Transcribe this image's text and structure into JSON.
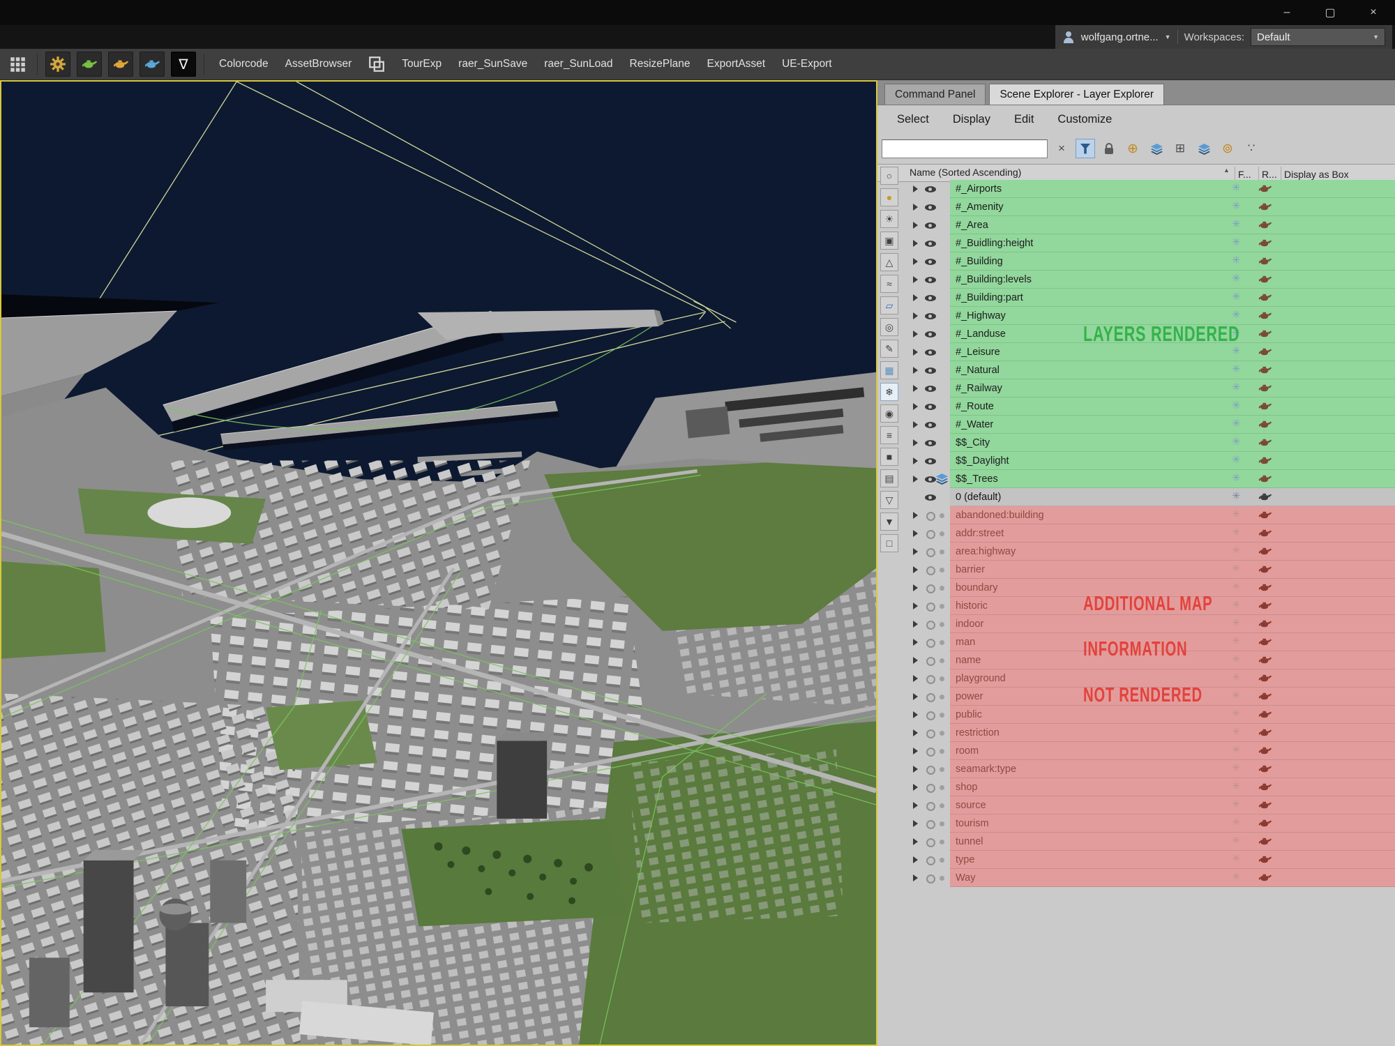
{
  "window": {
    "minimize": "–",
    "maximize": "▢",
    "close": "×"
  },
  "account_bar": {
    "user": "wolfgang.ortne...",
    "workspaces_label": "Workspaces:",
    "workspace_value": "Default"
  },
  "toolbar": {
    "group1": [
      {
        "label": "Colorcode",
        "name": "toolbar-button-colorcode"
      },
      {
        "label": "AssetBrowser",
        "name": "toolbar-button-assetbrowser"
      }
    ],
    "group2": [
      {
        "label": "TourExp",
        "name": "toolbar-button-tourexp"
      },
      {
        "label": "raer_SunSave",
        "name": "toolbar-button-raer-sunsave"
      },
      {
        "label": "raer_SunLoad",
        "name": "toolbar-button-raer-sunload"
      },
      {
        "label": "ResizePlane",
        "name": "toolbar-button-resizeplane"
      },
      {
        "label": "ExportAsset",
        "name": "toolbar-button-exportasset"
      },
      {
        "label": "UE-Export",
        "name": "toolbar-button-ue-export"
      }
    ]
  },
  "explorer": {
    "tab_inactive": "Command Panel",
    "tab_active": "Scene Explorer - Layer Explorer",
    "menu_items": [
      {
        "label": "Select",
        "name": "explorer-menu-select"
      },
      {
        "label": "Display",
        "name": "explorer-menu-display"
      },
      {
        "label": "Edit",
        "name": "explorer-menu-edit"
      },
      {
        "label": "Customize",
        "name": "explorer-menu-customize"
      }
    ],
    "search_value": "",
    "columns": {
      "name": "Name (Sorted Ascending)",
      "sort": "▲",
      "frozen": "F...",
      "render": "R...",
      "display": "Display as Box"
    },
    "side_icons": [
      {
        "n": "display-all-icon",
        "g": "○"
      },
      {
        "n": "display-geometry-icon",
        "g": "●"
      },
      {
        "n": "display-lights-icon",
        "g": "☀"
      },
      {
        "n": "display-cameras-icon",
        "g": "▣"
      },
      {
        "n": "display-helpers-icon",
        "g": "△"
      },
      {
        "n": "display-spacewarps-icon",
        "g": "≈"
      },
      {
        "n": "display-shapes-icon",
        "g": "▱"
      },
      {
        "n": "display-xrefs-icon",
        "g": "◎"
      },
      {
        "n": "display-bones-icon",
        "g": "✎"
      },
      {
        "n": "display-containers-icon",
        "g": "▦"
      },
      {
        "n": "filter-frozen-icon",
        "g": "❄"
      },
      {
        "n": "filter-hidden-icon",
        "g": "◉"
      },
      {
        "n": "display-list-icon",
        "g": "≡"
      },
      {
        "n": "display-materials-icon",
        "g": "■"
      },
      {
        "n": "display-notes-icon",
        "g": "▤"
      },
      {
        "n": "filter-combinations-icon",
        "g": "▽"
      },
      {
        "n": "filter-custom-icon",
        "g": "▼"
      },
      {
        "n": "archive-icon",
        "g": "□"
      }
    ],
    "layers_rendered": [
      "#_Airports",
      "#_Amenity",
      "#_Area",
      "#_Buidling:height",
      "#_Building",
      "#_Building:levels",
      "#_Building:part",
      "#_Highway",
      "#_Landuse",
      "#_Leisure",
      "#_Natural",
      "#_Railway",
      "#_Route",
      "#_Water",
      "$$_City",
      "$$_Daylight",
      "$$_Trees"
    ],
    "layer_default": "0 (default)",
    "layers_hidden": [
      "abandoned:building",
      "addr:street",
      "area:highway",
      "barrier",
      "boundary",
      "historic",
      "indoor",
      "man",
      "name",
      "playground",
      "power",
      "public",
      "restriction",
      "room",
      "seamark:type",
      "shop",
      "source",
      "tourism",
      "tunnel",
      "type",
      "Way"
    ],
    "annotations": {
      "rendered": "LAYERS RENDERED",
      "info1": "ADDITIONAL MAP",
      "info2": "INFORMATION",
      "info3": "NOT RENDERED"
    },
    "colors": {
      "rendered_row": "#92d79c",
      "hidden_row": "#e39c9c",
      "annotation_green": "#2daf45",
      "annotation_red": "#e23b34",
      "viewport_border": "#d8c83a"
    }
  }
}
